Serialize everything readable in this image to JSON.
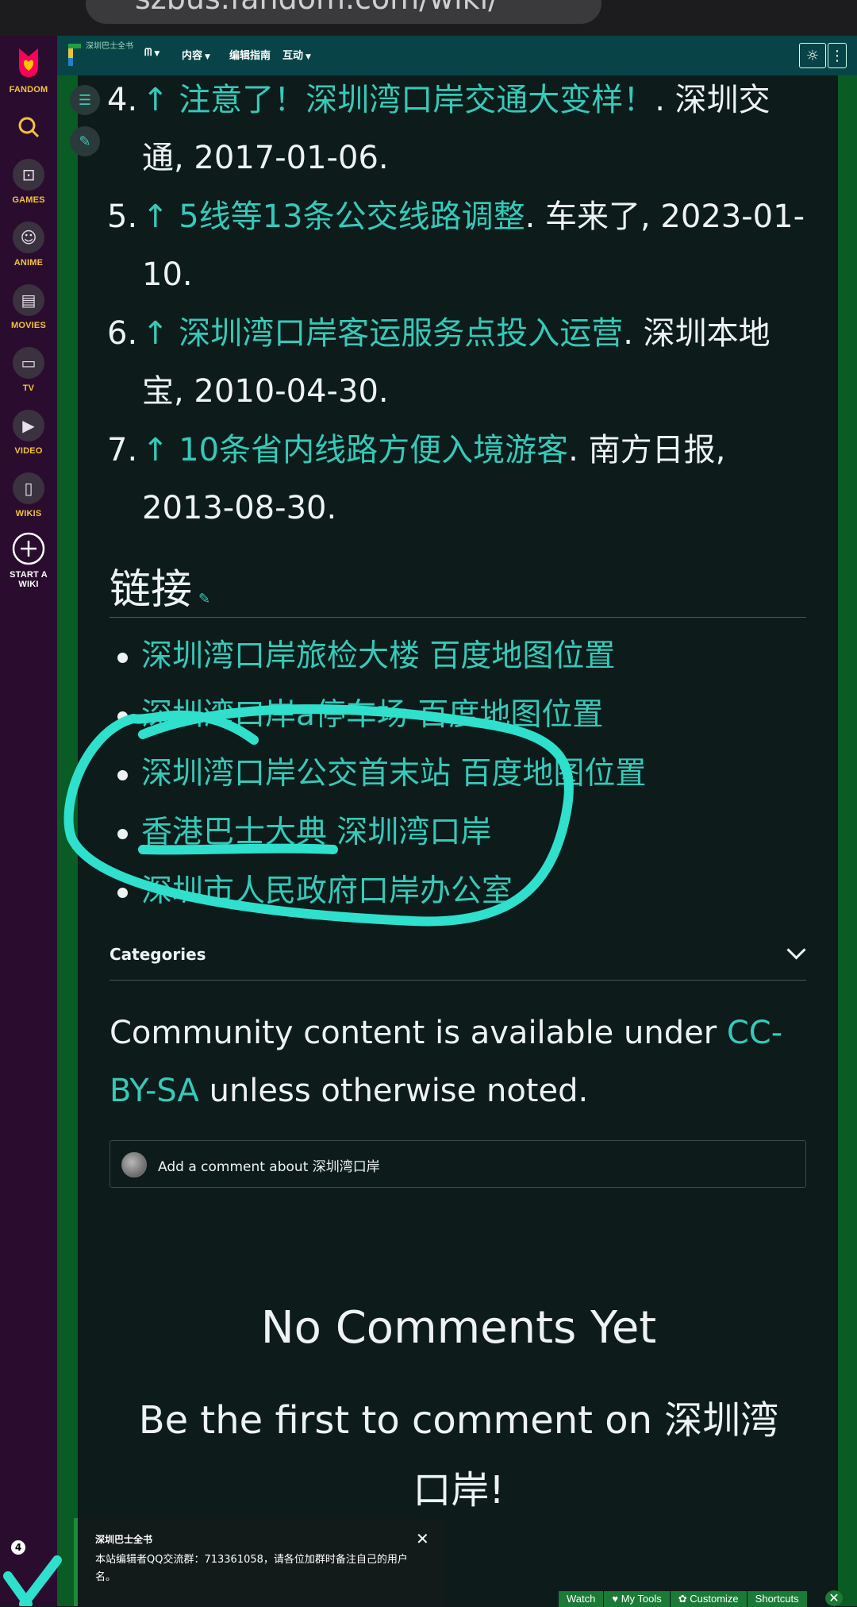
{
  "browser": {
    "url": "szbus.fandom.com/wiki/"
  },
  "fandom_rail": {
    "brand": "FANDOM",
    "items": [
      {
        "label": "GAMES"
      },
      {
        "label": "ANIME"
      },
      {
        "label": "MOVIES"
      },
      {
        "label": "TV"
      },
      {
        "label": "VIDEO"
      },
      {
        "label": "WIKIS"
      }
    ],
    "start_wiki": "START A WIKI"
  },
  "wiki_nav": {
    "logo_text": "深圳巴士全书",
    "items": [
      "",
      "内容",
      "编辑指南",
      "互动"
    ]
  },
  "references": [
    {
      "num": "4.",
      "link": "↑ 注意了！深圳湾口岸交通大变样！",
      "rest": ". 深圳交通, 2017-01-06."
    },
    {
      "num": "5.",
      "link": "↑ 5线等13条公交线路调整",
      "rest": ". 车来了, 2023-01-10."
    },
    {
      "num": "6.",
      "link": "↑ 深圳湾口岸客运服务点投入运营",
      "rest": ". 深圳本地宝, 2010-04-30."
    },
    {
      "num": "7.",
      "link": "↑ 10条省内线路方便入境游客",
      "rest": ". 南方日报, 2013-08-30."
    }
  ],
  "links_heading": "链接",
  "links": [
    {
      "a": "深圳湾口岸旅检大楼",
      "b": "百度地图位置"
    },
    {
      "a": "深圳湾口岸a停车场",
      "b": "百度地图位置"
    },
    {
      "a": "深圳湾口岸公交首末站",
      "b": "百度地图位置"
    },
    {
      "a": "香港巴士大典",
      "b": "深圳湾口岸"
    },
    {
      "a": "深圳市人民政府口岸办公室",
      "b": ""
    }
  ],
  "categories_label": "Categories",
  "license": {
    "before": "Community content is available under ",
    "link": "CC-BY-SA",
    "after": " unless otherwise noted."
  },
  "comment_placeholder": "Add a comment about 深圳湾口岸",
  "no_comments_title": "No Comments Yet",
  "first_comment_text": "Be the first to comment on 深圳湾口岸!",
  "toast": {
    "title": "深圳巴士全书",
    "message": "本站编辑者QQ交流群：713361058，请各位加群时备注自己的用户名。"
  },
  "notification_count": "4",
  "bottom_toolbar": [
    "Watch",
    "♥ My Tools",
    "✿ Customize",
    "Shortcuts"
  ],
  "colors": {
    "link": "#37c9b8",
    "accent_green": "#1a7a36",
    "nav_teal": "#084447",
    "rail_purple": "#2a0d2e",
    "rail_label": "#f3c33b"
  }
}
